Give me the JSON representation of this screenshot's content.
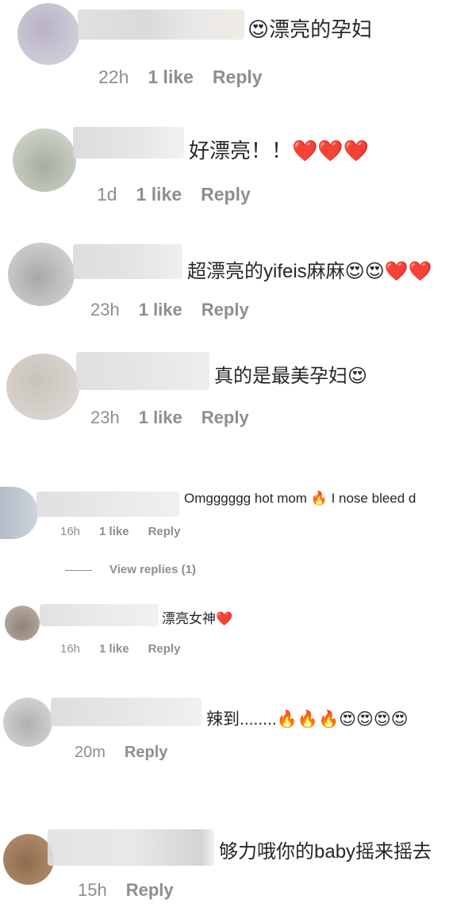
{
  "comments": [
    {
      "text": "😍漂亮的孕妇",
      "time": "22h",
      "likes": "1 like",
      "reply": "Reply"
    },
    {
      "text": "好漂亮！！❤️❤️❤️",
      "time": "1d",
      "likes": "1 like",
      "reply": "Reply"
    },
    {
      "text": "超漂亮的yifeis麻麻😍😍❤️❤️",
      "time": "23h",
      "likes": "1 like",
      "reply": "Reply"
    },
    {
      "text": "真的是最美孕妇😍",
      "time": "23h",
      "likes": "1 like",
      "reply": "Reply"
    },
    {
      "text": "Omgggggg hot mom 🔥 I nose bleed d",
      "time": "16h",
      "likes": "1 like",
      "reply": "Reply"
    },
    {
      "text": "漂亮女神❤️",
      "time": "16h",
      "likes": "1 like",
      "reply": "Reply"
    },
    {
      "text": "辣到........🔥🔥🔥😍😍😍😍",
      "time": "20m",
      "likes": "",
      "reply": "Reply"
    },
    {
      "text": "够力哦你的baby摇来摇去",
      "time": "15h",
      "likes": "",
      "reply": "Reply"
    }
  ],
  "view_replies": "View replies (1)"
}
